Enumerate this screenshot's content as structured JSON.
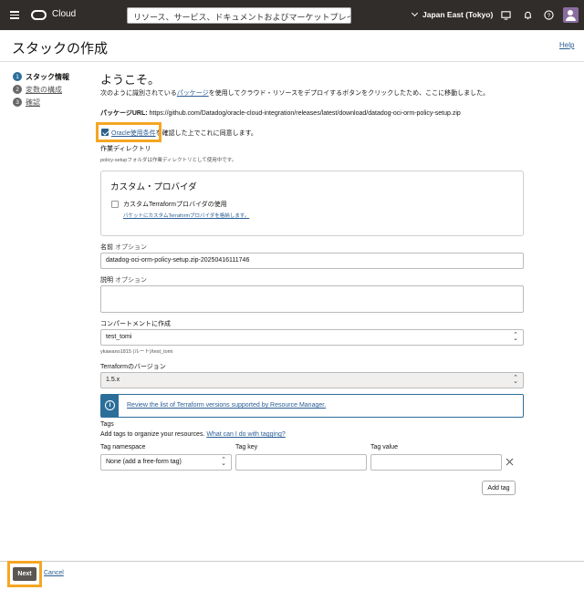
{
  "topbar": {
    "cloud_label": "Cloud",
    "search_placeholder": "リソース、サービス、ドキュメントおよびマーケットプレイスの検索",
    "region": "Japan East (Tokyo)"
  },
  "page": {
    "title": "スタックの作成",
    "help": "Help"
  },
  "steps": [
    {
      "num": "1",
      "label": "スタック情報"
    },
    {
      "num": "2",
      "label": "変数の構成"
    },
    {
      "num": "3",
      "label": "確認"
    }
  ],
  "form": {
    "welcome": "ようこそ。",
    "intro_before": "次のように識別されている",
    "intro_link": "パッケージ",
    "intro_after": "を使用してクラウド・リソースをデプロイするボタンをクリックしたため、ここに移動しました。",
    "package_url_label": "パッケージURL:",
    "package_url": "https://github.com/Datadog/oracle-cloud-integration/releases/latest/download/datadog-oci-orm-policy-setup.zip",
    "terms_link": "Oracle使用条件",
    "terms_after": "を確認した上でこれに同意します。",
    "terms_checked": true,
    "workdir_label": "作業ディレクトリ",
    "workdir_note": "policy-setupフォルダは作業ディレクトリとして使用中です。",
    "custom_provider_title": "カスタム・プロバイダ",
    "custom_provider_checkbox": "カスタムTerraformプロバイダの使用",
    "custom_provider_link": "バケットにカスタムTerraformプロバイダを格納します。",
    "name_label": "名前",
    "name_optional": "オプション",
    "name_value": "datadog-oci-orm-policy-setup.zip-20250416111746",
    "desc_label": "説明",
    "desc_optional": "オプション",
    "compartment_label": "コンパートメントに作成",
    "compartment_value": "test_tomi",
    "compartment_path": "ykawano1815 (ルート)/test_tomi",
    "tf_version_label": "Terraformのバージョン",
    "tf_version_value": "1.5.x",
    "info_link": "Review the list of Terraform versions supported by Resource Manager.",
    "tags_title": "Tags",
    "tags_desc": "Add tags to organize your resources.",
    "tags_link": "What can I do with tagging?",
    "tag_namespace_label": "Tag namespace",
    "tag_namespace_value": "None (add a free-form tag)",
    "tag_key_label": "Tag key",
    "tag_value_label": "Tag value",
    "add_tag": "Add tag"
  },
  "footer": {
    "next": "Next",
    "cancel": "Cancel"
  },
  "colors": {
    "highlight": "#f5a623",
    "topbar": "#312d2a",
    "accent": "#2c6e9a"
  }
}
